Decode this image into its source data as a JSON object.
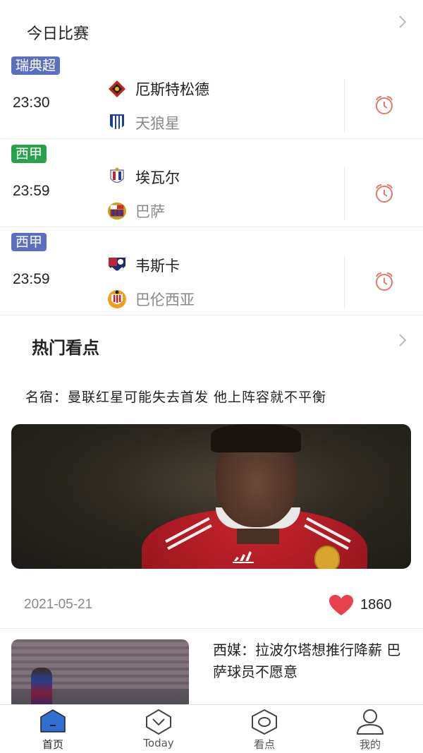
{
  "today": {
    "title": "今日比赛",
    "matches": [
      {
        "league": "瑞典超",
        "league_color": "#5b6fbf",
        "time": "23:30",
        "home": "厄斯特松德",
        "away": "天狼星"
      },
      {
        "league": "西甲",
        "league_color": "#27a24a",
        "time": "23:59",
        "home": "埃瓦尔",
        "away": "巴萨"
      },
      {
        "league": "西甲",
        "league_color": "#5b6fbf",
        "time": "23:59",
        "home": "韦斯卡",
        "away": "巴伦西亚"
      }
    ]
  },
  "hot": {
    "title": "热门看点",
    "featured": {
      "headline": "名宿：曼联红星可能失去首发 他上阵容就不平衡",
      "date": "2021-05-21",
      "likes": "1860"
    },
    "news": [
      {
        "title": "西媒：拉波尔塔想推行降薪 巴萨球员不愿意"
      }
    ]
  },
  "tabbar": {
    "tabs": [
      {
        "label": "首页",
        "icon": "home-icon"
      },
      {
        "label": "Today",
        "icon": "today-icon"
      },
      {
        "label": "看点",
        "icon": "highlights-icon"
      },
      {
        "label": "我的",
        "icon": "profile-icon"
      }
    ]
  },
  "colors": {
    "accent": "#2f6fd0",
    "alarm": "#e07a6a",
    "heart": "#e8414e"
  }
}
